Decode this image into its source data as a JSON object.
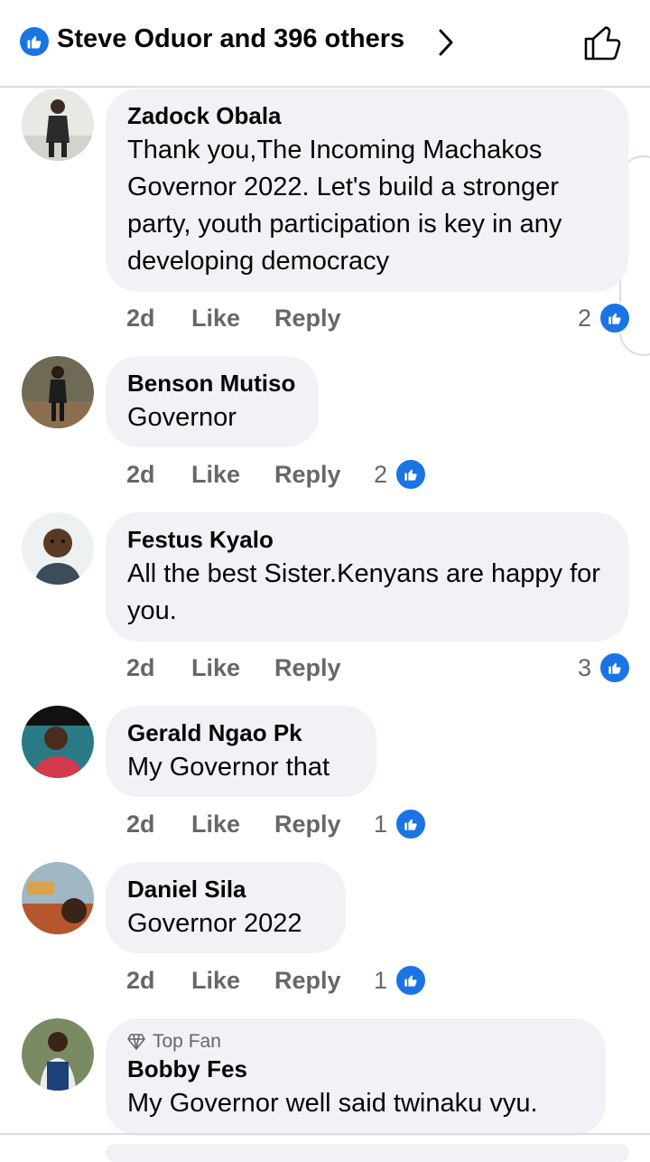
{
  "header": {
    "reactors": "Steve Oduor and 396 others"
  },
  "comments": [
    {
      "name": "Zadock Obala",
      "text": "Thank you,The Incoming Machakos Governor 2022. Let's build a stronger party, youth participation is key in any developing democracy",
      "time": "2d",
      "like": "Like",
      "reply": "Reply",
      "likes": "2"
    },
    {
      "name": "Benson Mutiso",
      "text": "Governor",
      "time": "2d",
      "like": "Like",
      "reply": "Reply",
      "likes": "2"
    },
    {
      "name": "Festus Kyalo",
      "text": "All the best Sister.Kenyans are happy for you.",
      "time": "2d",
      "like": "Like",
      "reply": "Reply",
      "likes": "3"
    },
    {
      "name": "Gerald Ngao Pk",
      "text": "My Governor that",
      "time": "2d",
      "like": "Like",
      "reply": "Reply",
      "likes": "1"
    },
    {
      "name": "Daniel Sila",
      "text": "Governor 2022",
      "time": "2d",
      "like": "Like",
      "reply": "Reply",
      "likes": "1"
    },
    {
      "badge": "Top Fan",
      "name": "Bobby Fes",
      "text": "My Governor well said twinaku vyu."
    }
  ],
  "colors": {
    "accent": "#1b74e4",
    "bubble": "#f0f2f5",
    "meta": "#65676b"
  }
}
